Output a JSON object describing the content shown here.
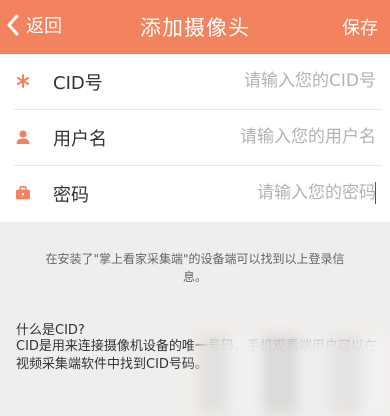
{
  "header": {
    "back_label": "返回",
    "title": "添加摄像头",
    "save_label": "保存",
    "color": "#f2835e"
  },
  "form": {
    "fields": [
      {
        "icon": "asterisk-icon",
        "label": "CID号",
        "placeholder": "请输入您的CID号",
        "value": ""
      },
      {
        "icon": "user-icon",
        "label": "用户名",
        "placeholder": "请输入您的用户名",
        "value": ""
      },
      {
        "icon": "briefcase-icon",
        "label": "密码",
        "placeholder": "请输入您的密码",
        "value": ""
      }
    ]
  },
  "hint": "在安装了\"掌上看家采集端\"的设备端可以找到以上登录信息。",
  "faq": {
    "question": "什么是CID?",
    "answer": "CID是用来连接摄像机设备的唯一号码，手机观看端用户可以在视频采集端软件中找到CID号码。"
  },
  "icon_color": "#f2835e"
}
